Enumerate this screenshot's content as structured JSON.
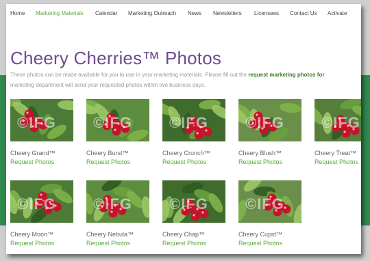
{
  "nav": {
    "items": [
      "Home",
      "Marketing Materials",
      "Calendar",
      "Marketing Outreach",
      "News",
      "Newsletters",
      "Licensees",
      "Contact Us",
      "Activate"
    ],
    "active_index": 1
  },
  "page": {
    "title": "Cheery Cherries™ Photos",
    "intro_line1": "These photos can be made available for you to use in your marketing materials. Please fill out the",
    "intro_link": "request marketing photos for",
    "intro_line2": "marketing department will send your requested photos within two business days."
  },
  "photos": [
    {
      "name": "Cheery Grand™",
      "link": "Request Photos"
    },
    {
      "name": "Cheery Burst™",
      "link": "Request Photos"
    },
    {
      "name": "Cheery Crunch™",
      "link": "Request Photos"
    },
    {
      "name": "Cheery Blush™",
      "link": "Request Photos"
    },
    {
      "name": "Cheery Treat™",
      "link": "Request Photos"
    },
    {
      "name": "Cheery Moon™",
      "link": "Request Photos"
    },
    {
      "name": "Cheery Nebula™",
      "link": "Request Photos"
    },
    {
      "name": "Cheery Chap™",
      "link": "Request Photos"
    },
    {
      "name": "Cheery Cupid™",
      "link": "Request Photos"
    }
  ],
  "watermark": "IFG",
  "colors": {
    "title": "#6e4a92",
    "link": "#5aa83a",
    "background": "#2f8a4e",
    "cherry": "#c4142b"
  }
}
